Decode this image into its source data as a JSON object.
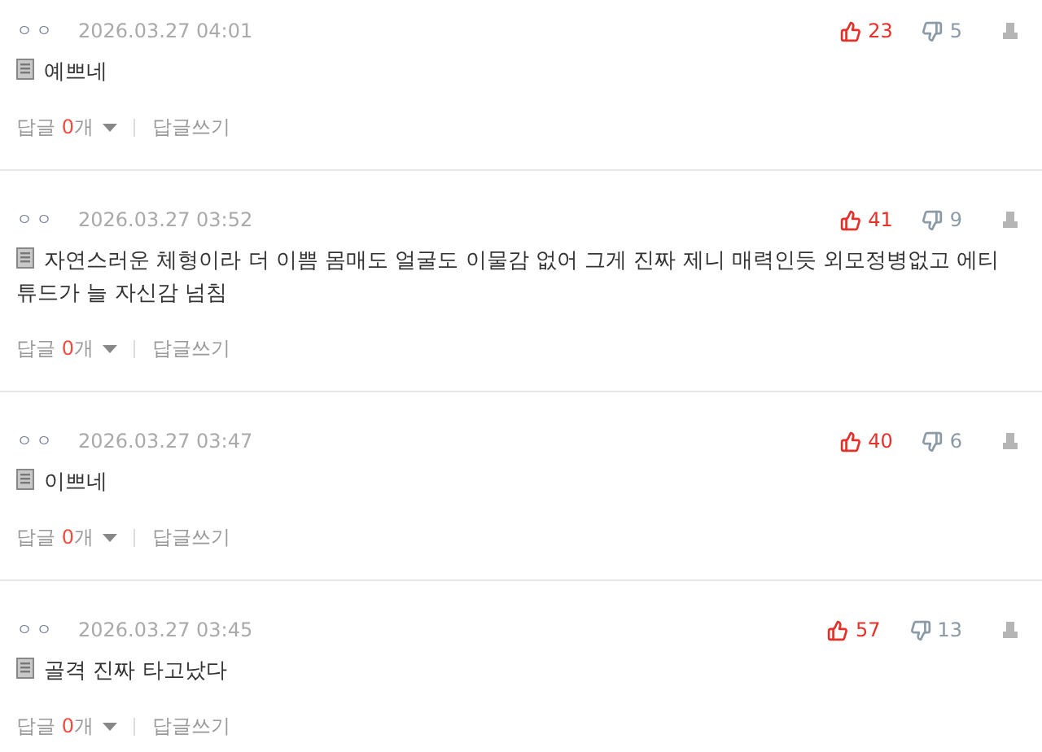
{
  "comments": [
    {
      "user": "ㅇㅇ",
      "date": "2026.03.27 04:01",
      "up": "23",
      "down": "5",
      "text": "예쁘네",
      "reply_label": "답글",
      "reply_count": "0",
      "reply_unit": "개",
      "write_reply": "답글쓰기"
    },
    {
      "user": "ㅇㅇ",
      "date": "2026.03.27 03:52",
      "up": "41",
      "down": "9",
      "text": "자연스러운 체형이라 더 이쁨 몸매도 얼굴도 이물감 없어 그게 진짜 제니 매력인듯 외모정병없고 에티튜드가 늘 자신감 넘침",
      "reply_label": "답글",
      "reply_count": "0",
      "reply_unit": "개",
      "write_reply": "답글쓰기"
    },
    {
      "user": "ㅇㅇ",
      "date": "2026.03.27 03:47",
      "up": "40",
      "down": "6",
      "text": "이쁘네",
      "reply_label": "답글",
      "reply_count": "0",
      "reply_unit": "개",
      "write_reply": "답글쓰기"
    },
    {
      "user": "ㅇㅇ",
      "date": "2026.03.27 03:45",
      "up": "57",
      "down": "13",
      "text": "골격 진짜 타고났다",
      "reply_label": "답글",
      "reply_count": "0",
      "reply_unit": "개",
      "write_reply": "답글쓰기"
    }
  ]
}
